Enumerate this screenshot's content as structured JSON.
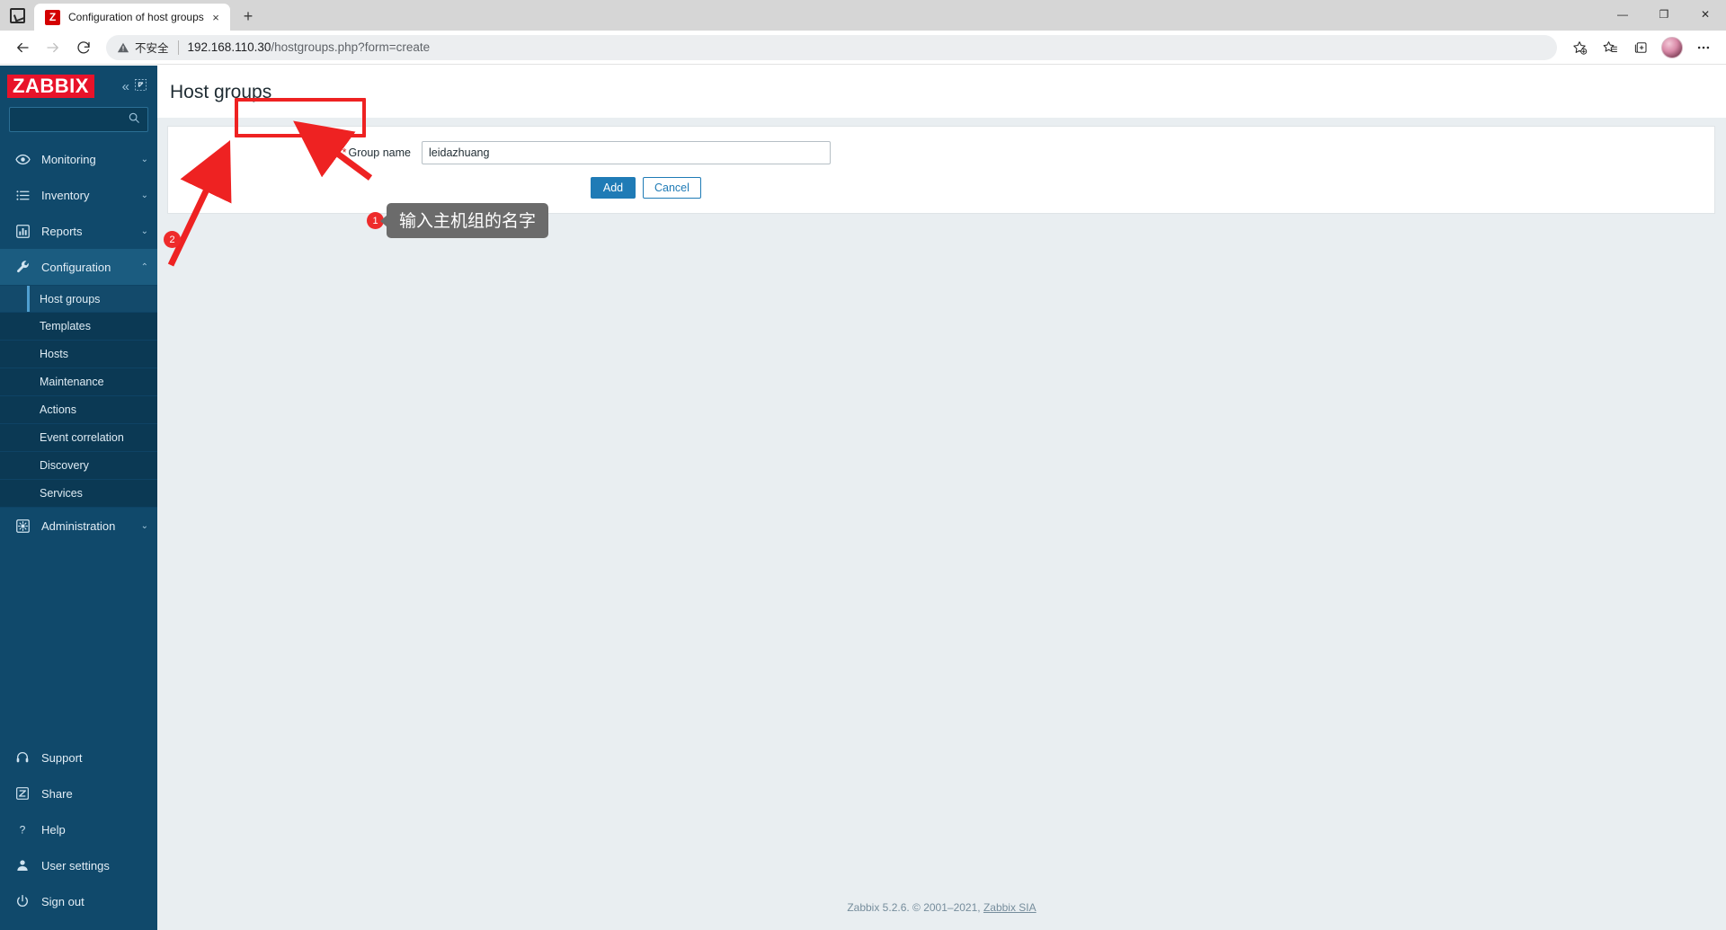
{
  "browser": {
    "tab": {
      "title": "Configuration of host groups",
      "favicon_letter": "Z",
      "close_label": "×"
    },
    "new_tab_label": "+",
    "window_controls": {
      "minimize": "—",
      "maximize": "❐",
      "close": "✕"
    },
    "nav": {
      "back": "←",
      "forward": "→",
      "reload": "⟳"
    },
    "omnibox": {
      "security_label": "不安全",
      "url_host": "192.168.110.30",
      "url_path": "/hostgroups.php?form=create"
    },
    "toolbar_icons": [
      "add-favorite-icon",
      "favorites-icon",
      "collections-icon",
      "profile-avatar",
      "settings-more-icon"
    ]
  },
  "sidebar": {
    "logo": "ZABBIX",
    "collapse_label": "«",
    "hide_label": "⤡",
    "search_placeholder": "",
    "search_value": "",
    "nav": [
      {
        "label": "Monitoring",
        "icon": "eye-icon",
        "caret": "⌄",
        "active": false
      },
      {
        "label": "Inventory",
        "icon": "list-icon",
        "caret": "⌄",
        "active": false
      },
      {
        "label": "Reports",
        "icon": "bar-chart-icon",
        "caret": "⌄",
        "active": false
      },
      {
        "label": "Configuration",
        "icon": "wrench-icon",
        "caret": "⌃",
        "active": true
      },
      {
        "label": "Administration",
        "icon": "gear-icon",
        "caret": "⌄",
        "active": false
      }
    ],
    "submenu": [
      {
        "label": "Host groups",
        "selected": true
      },
      {
        "label": "Templates",
        "selected": false
      },
      {
        "label": "Hosts",
        "selected": false
      },
      {
        "label": "Maintenance",
        "selected": false
      },
      {
        "label": "Actions",
        "selected": false
      },
      {
        "label": "Event correlation",
        "selected": false
      },
      {
        "label": "Discovery",
        "selected": false
      },
      {
        "label": "Services",
        "selected": false
      }
    ],
    "bottom": [
      {
        "label": "Support",
        "icon": "headset-icon"
      },
      {
        "label": "Share",
        "icon": "zabbix-share-icon"
      },
      {
        "label": "Help",
        "icon": "question-icon"
      },
      {
        "label": "User settings",
        "icon": "person-icon"
      },
      {
        "label": "Sign out",
        "icon": "power-icon"
      }
    ]
  },
  "main": {
    "page_title": "Host groups",
    "form": {
      "group_name_label": "Group name",
      "required_marker": "*",
      "group_name_value": "leidazhuang",
      "group_name_placeholder": "",
      "add_label": "Add",
      "cancel_label": "Cancel"
    },
    "footer": {
      "text": "Zabbix 5.2.6. © 2001–2021, ",
      "link": "Zabbix SIA"
    }
  },
  "annotations": [
    {
      "number": "1",
      "tooltip": "输入主机组的名字"
    },
    {
      "number": "2",
      "tooltip": ""
    }
  ],
  "colors": {
    "zabbix_red": "#e8132a",
    "sidebar_blue": "#10496b",
    "accent_blue": "#1f7bb6",
    "annotation_red": "#ee2222"
  }
}
